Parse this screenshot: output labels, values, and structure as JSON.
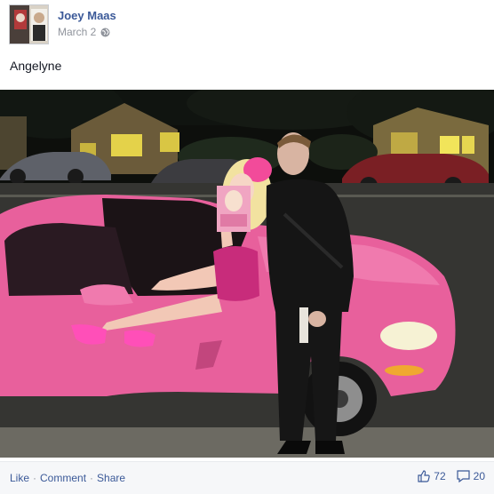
{
  "post": {
    "author": "Joey Maas",
    "date": "March 2",
    "caption": "Angelyne",
    "privacy_icon": "globe-icon"
  },
  "actions": {
    "like_label": "Like",
    "comment_label": "Comment",
    "share_label": "Share",
    "separator": "·"
  },
  "stats": {
    "likes": "72",
    "comments": "20",
    "like_icon": "thumbs-up-icon",
    "comment_icon": "comment-bubble-icon"
  },
  "colors": {
    "link": "#3b5998",
    "muted": "#90949c",
    "footer_bg": "#f6f7f9",
    "car_pink": "#e8609c"
  }
}
